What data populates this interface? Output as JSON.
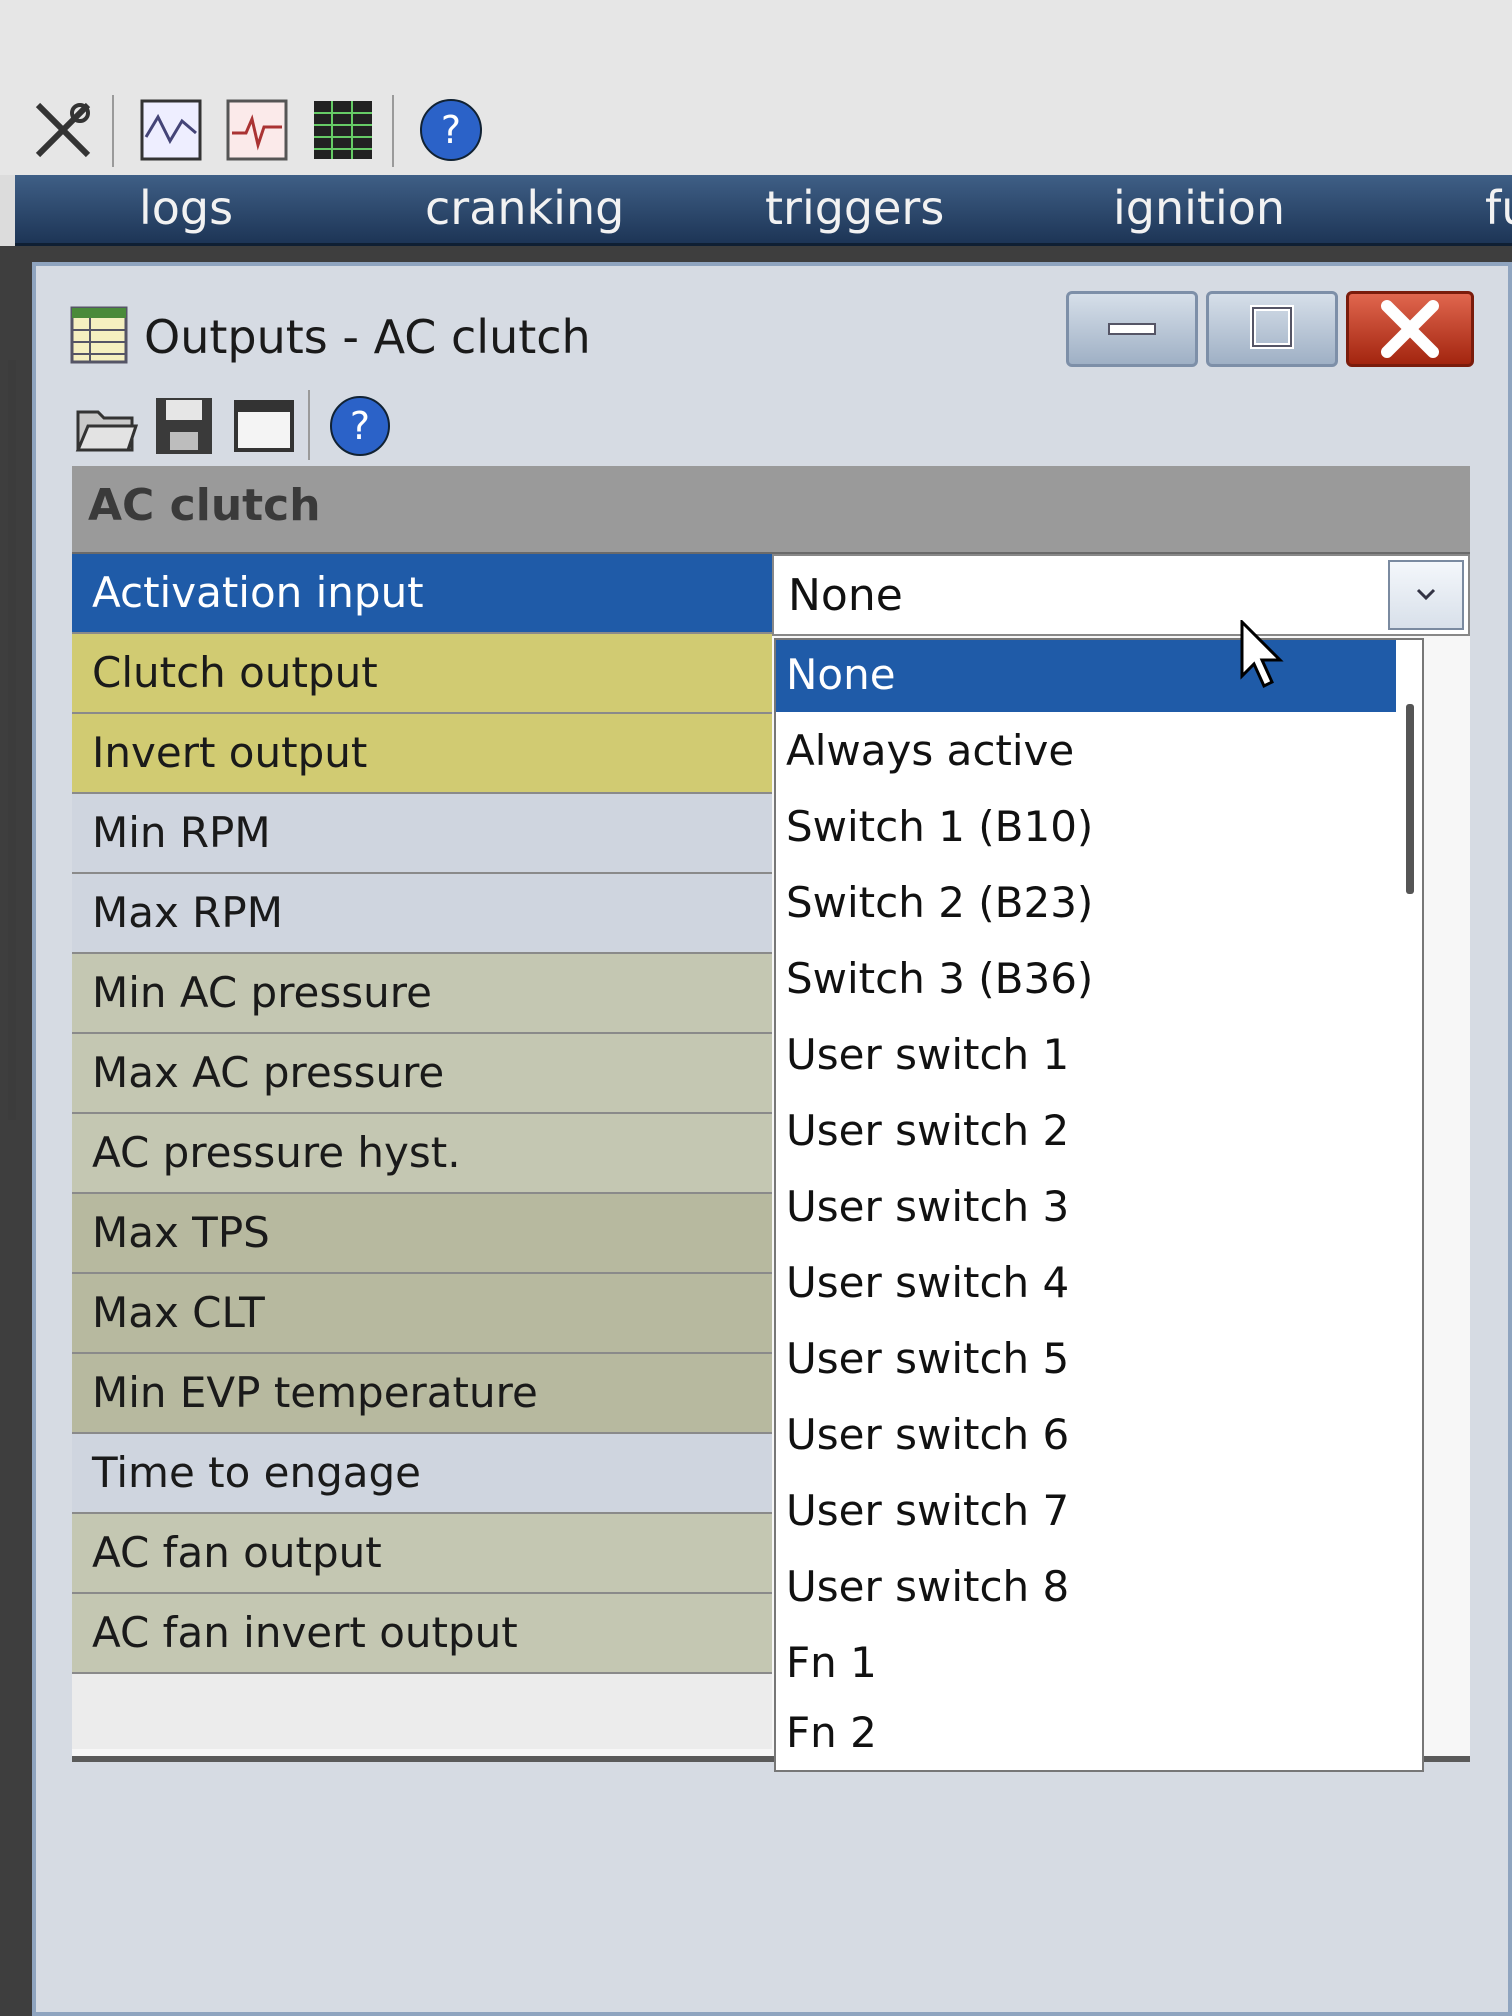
{
  "app": {
    "menu": [
      "logs",
      "cranking",
      "triggers",
      "ignition",
      "fu"
    ],
    "toolbar_icons": [
      "tools-icon",
      "graph-icon",
      "waveform-icon",
      "table-icon",
      "help-icon"
    ]
  },
  "dialog": {
    "title": "Outputs - AC clutch",
    "toolbar_icons": [
      "folder-open-icon",
      "save-icon",
      "window-icon",
      "help-icon"
    ]
  },
  "section": {
    "title": "AC clutch",
    "rows": [
      {
        "label": "Activation input",
        "style": "active"
      },
      {
        "label": "Clutch output",
        "style": "yellow"
      },
      {
        "label": "Invert output",
        "style": "yellow"
      },
      {
        "label": "Min RPM",
        "style": "light"
      },
      {
        "label": "Max RPM",
        "style": "light"
      },
      {
        "label": "Min AC pressure",
        "style": "tan"
      },
      {
        "label": "Max AC pressure",
        "style": "tan"
      },
      {
        "label": "AC pressure hyst.",
        "style": "tan"
      },
      {
        "label": "Max TPS",
        "style": "olive"
      },
      {
        "label": "Max CLT",
        "style": "olive"
      },
      {
        "label": "Min EVP temperature",
        "style": "olive"
      },
      {
        "label": "Time to engage",
        "style": "light"
      },
      {
        "label": "AC fan output",
        "style": "tan"
      },
      {
        "label": "AC fan invert output",
        "style": "tan"
      }
    ]
  },
  "combo": {
    "value": "None",
    "options": [
      "None",
      "Always active",
      "Switch 1 (B10)",
      "Switch 2 (B23)",
      "Switch 3 (B36)",
      "User switch 1",
      "User switch 2",
      "User switch 3",
      "User switch 4",
      "User switch 5",
      "User switch 6",
      "User switch 7",
      "User switch 8",
      "Fn 1",
      "Fn 2"
    ],
    "selected_index": 0
  },
  "colors": {
    "selection": "#1f5ba8",
    "yellow_row": "#d1cb72",
    "close_button": "#c0391f"
  }
}
